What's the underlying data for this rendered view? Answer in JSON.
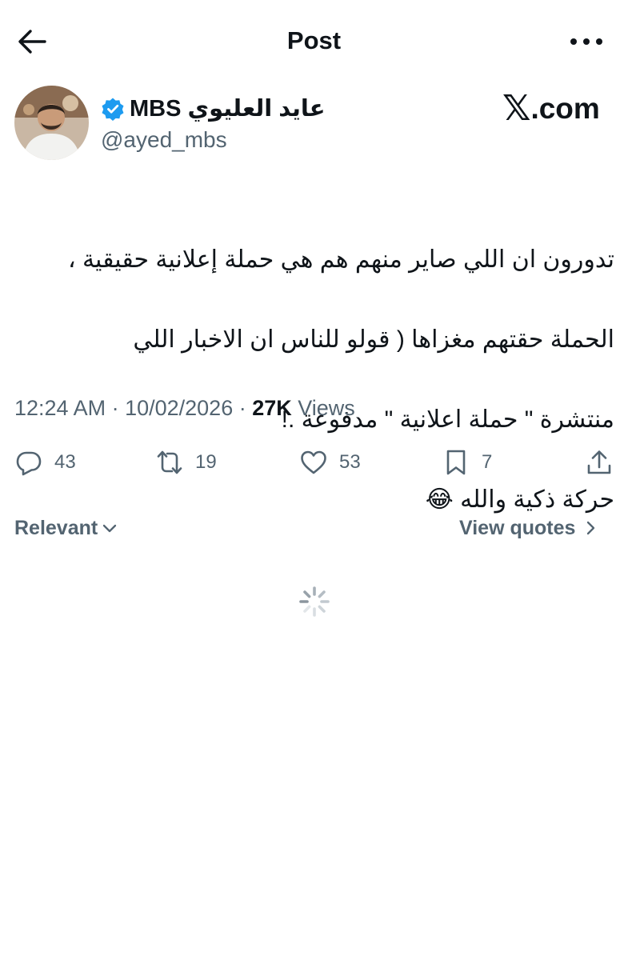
{
  "header": {
    "title": "Post",
    "back_icon": "arrow-left-icon",
    "more_icon": "more-horizontal-icon"
  },
  "author": {
    "name": "عايد العليوي MBS",
    "handle": "@ayed_mbs",
    "verified": true,
    "verified_color": "#1d9bf0",
    "avatar_icon": "user-avatar"
  },
  "watermark": {
    "glyph": "𝕏",
    "text": ".com"
  },
  "tweet": {
    "lines": [
      "تدورون ان اللي صاير منهم هم هي حملة إعلانية حقيقية ،",
      "الحملة حقتهم مغزاها ( قولو للناس ان الاخبار اللي",
      "منتشرة \" حملة اعلانية \" مدفوعة .!",
      "حركة ذكية والله 😂"
    ]
  },
  "meta": {
    "time": "12:24 AM",
    "separator": " · ",
    "date": "10/02/2026",
    "views_count": "27K",
    "views_label": " Views"
  },
  "actions": {
    "replies": "43",
    "reposts": "19",
    "likes": "53",
    "bookmarks": "7"
  },
  "replies_bar": {
    "sort_label": "Relevant",
    "quotes_label": "View quotes"
  },
  "colors": {
    "text": "#0f1419",
    "secondary": "#536471",
    "accent": "#1d9bf0"
  }
}
